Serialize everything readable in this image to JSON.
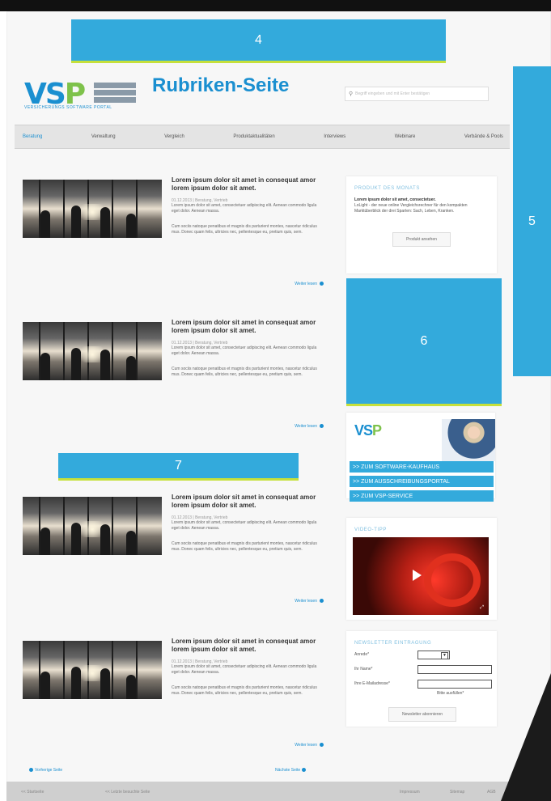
{
  "callouts": {
    "c4": "4",
    "c5": "5",
    "c6": "6",
    "c7": "7"
  },
  "header": {
    "logo_text": "VSP",
    "logo_tagline": "VERSICHERUNGS SOFTWARE PORTAL",
    "title": "Rubriken-Seite",
    "search_placeholder": "Begriff eingeben und mit Enter bestätigen"
  },
  "nav": [
    "Beratung",
    "Verwaltung",
    "Vergleich",
    "Produktaktualitäten",
    "Interviews",
    "Webinare",
    "Verbände & Pools"
  ],
  "nav_active_index": 0,
  "articles": [
    {
      "headline": "Lorem ipsum dolor sit amet in consequat amor lorem ipsum dolor sit amet.",
      "meta": "01.12.2013 | Beratung, Vertrieb",
      "p1": "Lorem ipsum dolor sit amet, consectetuer adipiscing elit. Aenean commodo ligula eget dolor. Aenean massa.",
      "p2": "Cum sociis natoque penatibus et magnis dis parturient montes, nascetur ridiculus mus. Donec quam felis, ultricies nec, pellentesque eu, pretium quis, sem.",
      "more": "Weiter lesen"
    },
    {
      "headline": "Lorem ipsum dolor sit amet in consequat amor lorem ipsum dolor sit amet.",
      "meta": "01.12.2013 | Beratung, Vertrieb",
      "p1": "Lorem ipsum dolor sit amet, consectetuer adipiscing elit. Aenean commodo ligula eget dolor. Aenean massa.",
      "p2": "Cum sociis natoque penatibus et magnis dis parturient montes, nascetur ridiculus mus. Donec quam felis, ultricies nec, pellentesque eu, pretium quis, sem.",
      "more": "Weiter lesen"
    },
    {
      "headline": "Lorem ipsum dolor sit amet in consequat amor lorem ipsum dolor sit amet.",
      "meta": "01.12.2013 | Beratung, Vertrieb",
      "p1": "Lorem ipsum dolor sit amet, consectetuer adipiscing elit. Aenean commodo ligula eget dolor. Aenean massa.",
      "p2": "Cum sociis natoque penatibus et magnis dis parturient montes, nascetur ridiculus mus. Donec quam felis, ultricies nec, pellentesque eu, pretium quis, sem.",
      "more": "Weiter lesen"
    },
    {
      "headline": "Lorem ipsum dolor sit amet in consequat amor lorem ipsum dolor sit amet.",
      "meta": "01.12.2013 | Beratung, Vertrieb",
      "p1": "Lorem ipsum dolor sit amet, consectetuer adipiscing elit. Aenean commodo ligula eget dolor. Aenean massa.",
      "p2": "Cum sociis natoque penatibus et magnis dis parturient montes, nascetur ridiculus mus. Donec quam felis, ultricies nec, pellentesque eu, pretium quis, sem.",
      "more": "Weiter lesen"
    }
  ],
  "product": {
    "title": "PRODUKT DES MONATS",
    "lead": "Lorem ipsum dolor sit amet, consectetuer.",
    "body": "LoLight - der neue online Vergleichsrechner für den kompakten Marktüberblick der drei Sparten: Sach, Leben, Kranken.",
    "button": "Produkt ansehen"
  },
  "banner": {
    "logo": "VSP",
    "links": [
      ">> ZUM SOFTWARE-KAUFHAUS",
      ">> ZUM AUSSCHREIBUNGSPORTAL",
      ">> ZUM VSP-SERVICE"
    ]
  },
  "video": {
    "title": "VIDEO-TIPP"
  },
  "newsletter": {
    "title": "NEWSLETTER EINTRAGUNG",
    "anrede_label": "Anrede*",
    "name_label": "Ihr Name*",
    "email_label": "Ihre E-Mailadresse*",
    "hint": "Bitte ausfüllen*",
    "button": "Newsletter abonnieren"
  },
  "pager": {
    "prev": "Vorherige Seite",
    "next": "Nächste Seite"
  },
  "footer": [
    "<< Startseite",
    "<< Letzte besuchte Seite",
    "Impressum",
    "Sitemap",
    "AGB"
  ],
  "colors": {
    "accent": "#33aadc",
    "brand": "#1a8fd0",
    "green": "#7ec24b"
  }
}
